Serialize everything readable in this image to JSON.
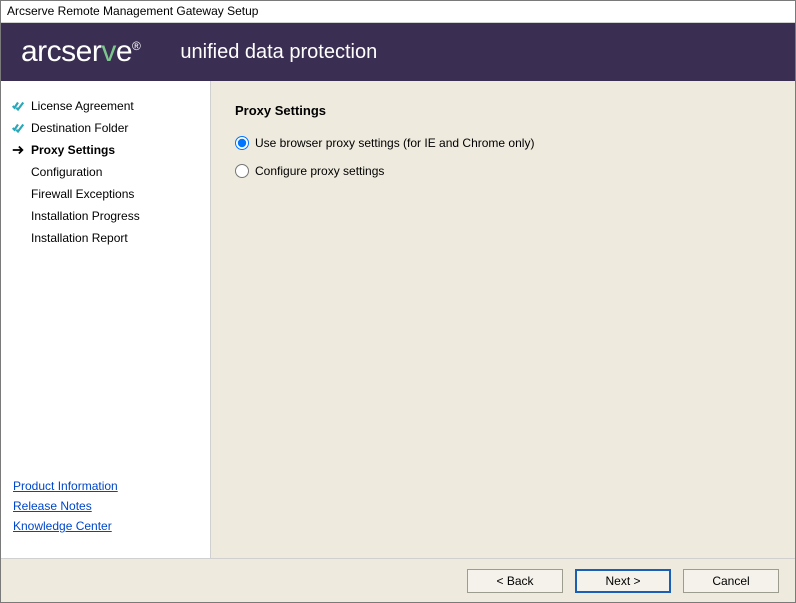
{
  "window": {
    "title": "Arcserve Remote Management Gateway Setup"
  },
  "header": {
    "logo_prefix": "arcser",
    "logo_v": "v",
    "logo_suffix": "e",
    "logo_reg": "®",
    "tagline": "unified data protection"
  },
  "sidebar": {
    "steps": [
      {
        "label": "License Agreement",
        "state": "done"
      },
      {
        "label": "Destination Folder",
        "state": "done"
      },
      {
        "label": "Proxy Settings",
        "state": "current"
      },
      {
        "label": "Configuration",
        "state": "pending"
      },
      {
        "label": "Firewall Exceptions",
        "state": "pending"
      },
      {
        "label": "Installation Progress",
        "state": "pending"
      },
      {
        "label": "Installation Report",
        "state": "pending"
      }
    ],
    "links": {
      "product_info": "Product Information",
      "release_notes": "Release Notes",
      "knowledge_center": "Knowledge Center"
    }
  },
  "main": {
    "title": "Proxy Settings",
    "option_browser": "Use browser proxy settings (for IE and Chrome only)",
    "option_configure": "Configure proxy settings"
  },
  "footer": {
    "back": "< Back",
    "next": "Next >",
    "cancel": "Cancel"
  }
}
